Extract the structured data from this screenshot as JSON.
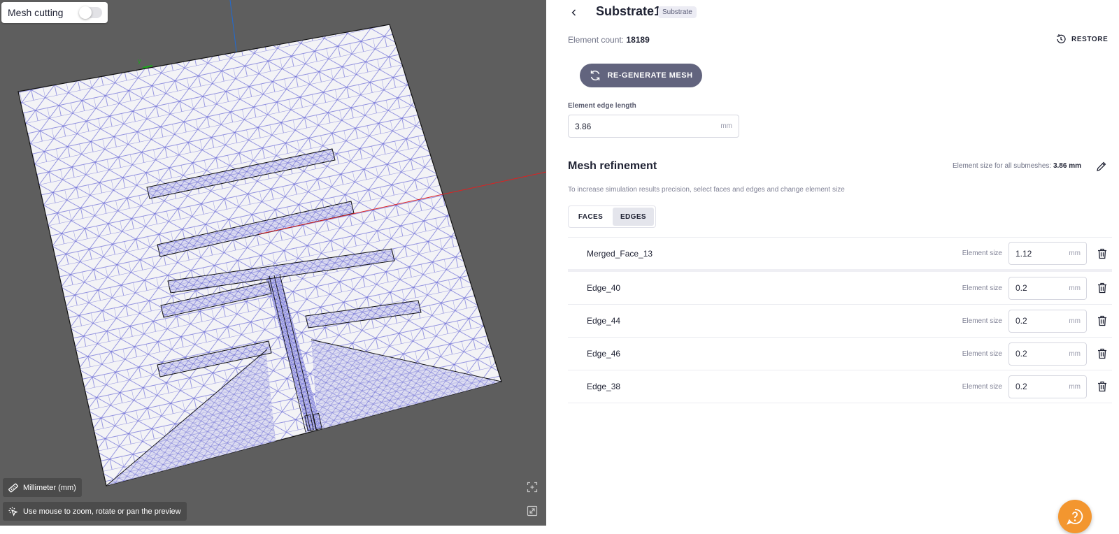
{
  "viewport": {
    "mesh_cutting_label": "Mesh cutting",
    "mesh_cutting_enabled": false,
    "axis_y_label": "y",
    "units_label": "Millimeter (mm)",
    "hint_label": "Use mouse to zoom, rotate or pan the preview",
    "colors": {
      "background": "#5e5e5e",
      "mesh": "#6e6ed6",
      "x_axis": "#e02020",
      "z_axis": "#1e6bd6",
      "y_axis": "#18a818"
    }
  },
  "panel": {
    "title": "Substrate1",
    "badge": "Substrate",
    "element_count_label": "Element count:",
    "element_count_value": "18189",
    "restore_label": "RESTORE",
    "regenerate_label": "RE-GENERATE MESH",
    "edge_length_label": "Element edge length",
    "edge_length_value": "3.86",
    "edge_length_unit": "mm",
    "refinement": {
      "title": "Mesh refinement",
      "meta_label": "Element size for all submeshes:",
      "meta_value": "3.86 mm",
      "description": "To increase simulation results precision, select faces and edges and change element size",
      "tabs": [
        {
          "label": "FACES",
          "active": false
        },
        {
          "label": "EDGES",
          "active": true
        }
      ],
      "size_label": "Element size",
      "unit": "mm",
      "items": [
        {
          "name": "Merged_Face_13",
          "size": "1.12"
        },
        {
          "name": "Edge_40",
          "size": "0.2"
        },
        {
          "name": "Edge_44",
          "size": "0.2"
        },
        {
          "name": "Edge_46",
          "size": "0.2"
        },
        {
          "name": "Edge_38",
          "size": "0.2"
        }
      ]
    },
    "accent_color": "#f3962f",
    "button_color": "#62647e"
  }
}
